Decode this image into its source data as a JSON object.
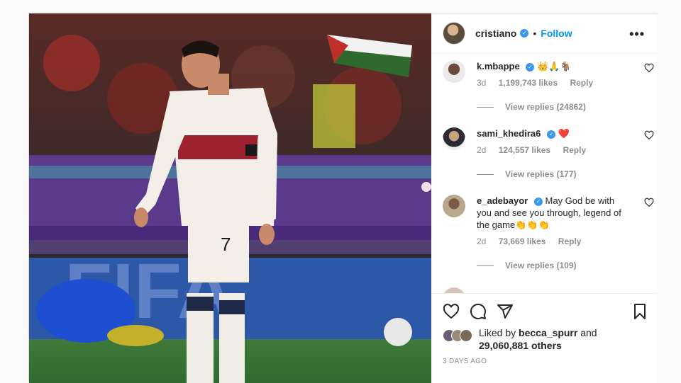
{
  "header": {
    "username": "cristiano",
    "separator": "•",
    "follow_label": "Follow",
    "more_label": "•••"
  },
  "comments": [
    {
      "username": "k.mbappe",
      "text": "👑🙏🐐",
      "age": "3d",
      "likes": "1,199,743 likes",
      "reply_label": "Reply",
      "view_replies": "View replies (24862)"
    },
    {
      "username": "sami_khedira6",
      "text": "❤️",
      "age": "2d",
      "likes": "124,557 likes",
      "reply_label": "Reply",
      "view_replies": "View replies (177)"
    },
    {
      "username": "e_adebayor",
      "text": "May God be with you and see you through, legend of the game👏👏👏",
      "age": "2d",
      "likes": "73,669 likes",
      "reply_label": "Reply",
      "view_replies": "View replies (109)"
    }
  ],
  "liked_by": {
    "prefix": "Liked by",
    "user": "becca_spurr",
    "and": "and",
    "others": "29,060,881 others"
  },
  "timestamp": "3 DAYS AGO",
  "colors": {
    "link_blue": "#0095f6",
    "verified_blue": "#3897f0",
    "muted": "#8e8e8e",
    "heart_red": "#ed4956"
  },
  "icons": {
    "like": "heart-icon",
    "comment": "comment-icon",
    "share": "paper-plane-icon",
    "save": "bookmark-icon"
  }
}
